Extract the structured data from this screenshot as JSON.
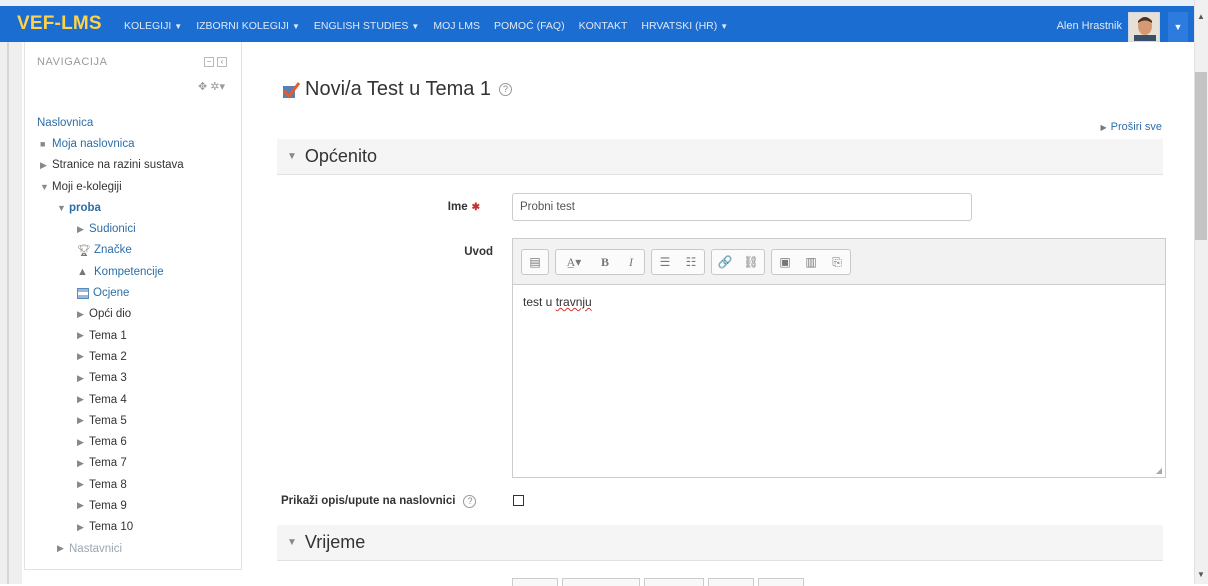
{
  "navbar": {
    "brand": "VEF-LMS",
    "menu": [
      {
        "label": "KOLEGIJI",
        "caret": "▼"
      },
      {
        "label": "IZBORNI KOLEGIJI",
        "caret": "▼"
      },
      {
        "label": "ENGLISH STUDIES",
        "caret": "▼"
      },
      {
        "label": "MOJ LMS",
        "caret": ""
      },
      {
        "label": "POMOĆ (FAQ)",
        "caret": ""
      },
      {
        "label": "KONTAKT",
        "caret": ""
      },
      {
        "label": "HRVATSKI (HR)",
        "caret": "▼"
      }
    ],
    "user_name": "Alen Hrastnik",
    "user_caret": "▼"
  },
  "navigation": {
    "heading": "NAVIGACIJA",
    "tools": "✥ ✲▾",
    "items": [
      {
        "label": "Naslovnica",
        "marker": ""
      },
      {
        "label": "Moja naslovnica",
        "marker": "■"
      },
      {
        "label": "Stranice na razini sustava",
        "marker": "▶"
      },
      {
        "label": "Moji e-kolegiji",
        "marker": "▼"
      },
      {
        "label": "proba",
        "marker": "▼"
      },
      {
        "label": "Sudionici",
        "marker": "▶"
      },
      {
        "label": "Značke",
        "icon": "trophy-icon"
      },
      {
        "label": "Kompetencije",
        "icon": "competency-icon"
      },
      {
        "label": "Ocjene",
        "icon": "grades-table-icon"
      },
      {
        "label": "Opći dio",
        "marker": "▶"
      },
      {
        "label": "Tema 1",
        "marker": "▶"
      },
      {
        "label": "Tema 2",
        "marker": "▶"
      },
      {
        "label": "Tema 3",
        "marker": "▶"
      },
      {
        "label": "Tema 4",
        "marker": "▶"
      },
      {
        "label": "Tema 5",
        "marker": "▶"
      },
      {
        "label": "Tema 6",
        "marker": "▶"
      },
      {
        "label": "Tema 7",
        "marker": "▶"
      },
      {
        "label": "Tema 8",
        "marker": "▶"
      },
      {
        "label": "Tema 9",
        "marker": "▶"
      },
      {
        "label": "Tema 10",
        "marker": "▶"
      },
      {
        "label": "Nastavnici",
        "marker": "▶"
      }
    ]
  },
  "main": {
    "title": "Novi/a Test u Tema 1",
    "help": "?",
    "expand_all": "Proširi sve",
    "sections": {
      "general": "Općenito",
      "timing": "Vrijeme"
    },
    "fields": {
      "name_label": "Ime",
      "name_required": "✱",
      "name_value": "Probni test",
      "intro_label": "Uvod",
      "intro_text_a": "test u ",
      "intro_text_b": "travnju",
      "show_description_label": "Prikaži opis/upute na naslovnici"
    },
    "toolbar_glyphs": [
      "▤",
      "A̲▾",
      "B",
      "I",
      "☰",
      "☷",
      "🔗",
      "⛓",
      "▣",
      "▥",
      "⎘"
    ]
  },
  "colors": {
    "navbar_bg": "#1b6dd1",
    "brand": "#ffd24a",
    "link": "#2d6ea8",
    "required": "#c9302c"
  }
}
